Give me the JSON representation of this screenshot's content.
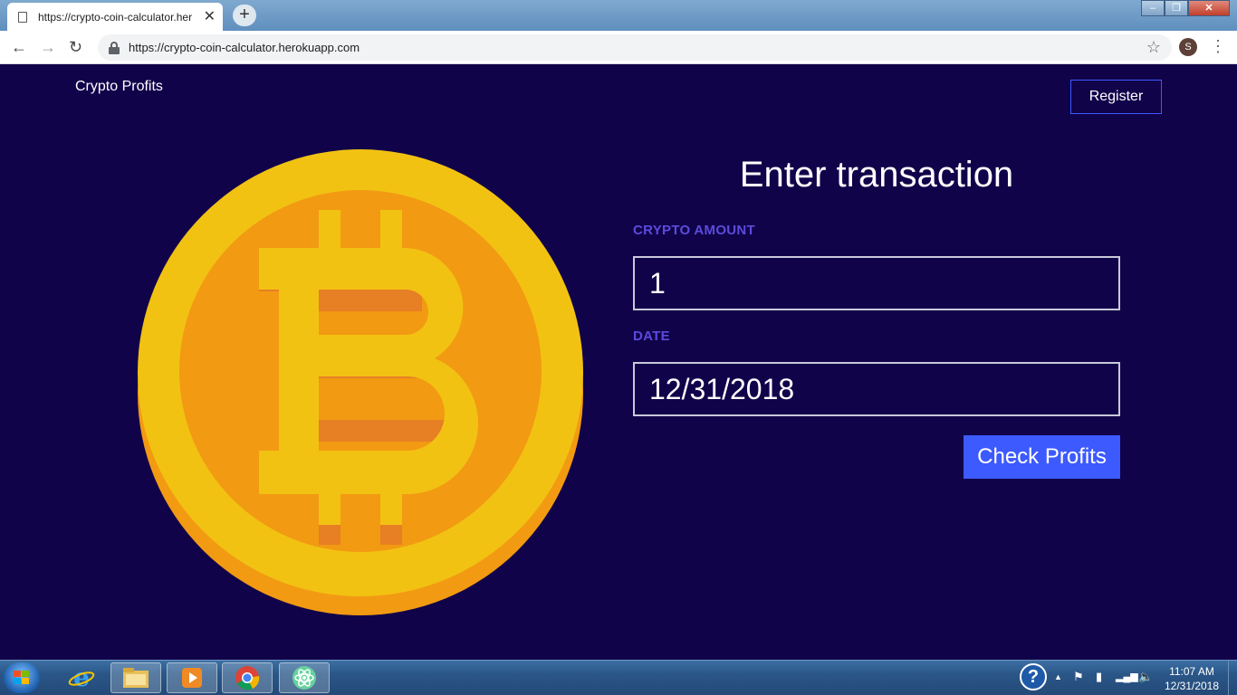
{
  "browser": {
    "tab_title": "https://crypto-coin-calculator.her",
    "new_tab_symbol": "+",
    "url": "https://crypto-coin-calculator.herokuapp.com",
    "profile_initial": "S"
  },
  "header": {
    "brand": "Crypto Profits",
    "register_label": "Register"
  },
  "form": {
    "title": "Enter transaction",
    "amount_label": "CRYPTO AMOUNT",
    "amount_value": "1",
    "date_label": "DATE",
    "date_value": "12/31/2018",
    "submit_label": "Check Profits"
  },
  "taskbar": {
    "clock_time": "11:07 AM",
    "clock_date": "12/31/2018",
    "help_symbol": "?"
  },
  "colors": {
    "page_background": "#11034a",
    "accent": "#3d5afe",
    "label": "#5a4bdc",
    "coin_outer": "#f2c213",
    "coin_inner": "#f29a12",
    "coin_shadow": "#e77f25"
  }
}
